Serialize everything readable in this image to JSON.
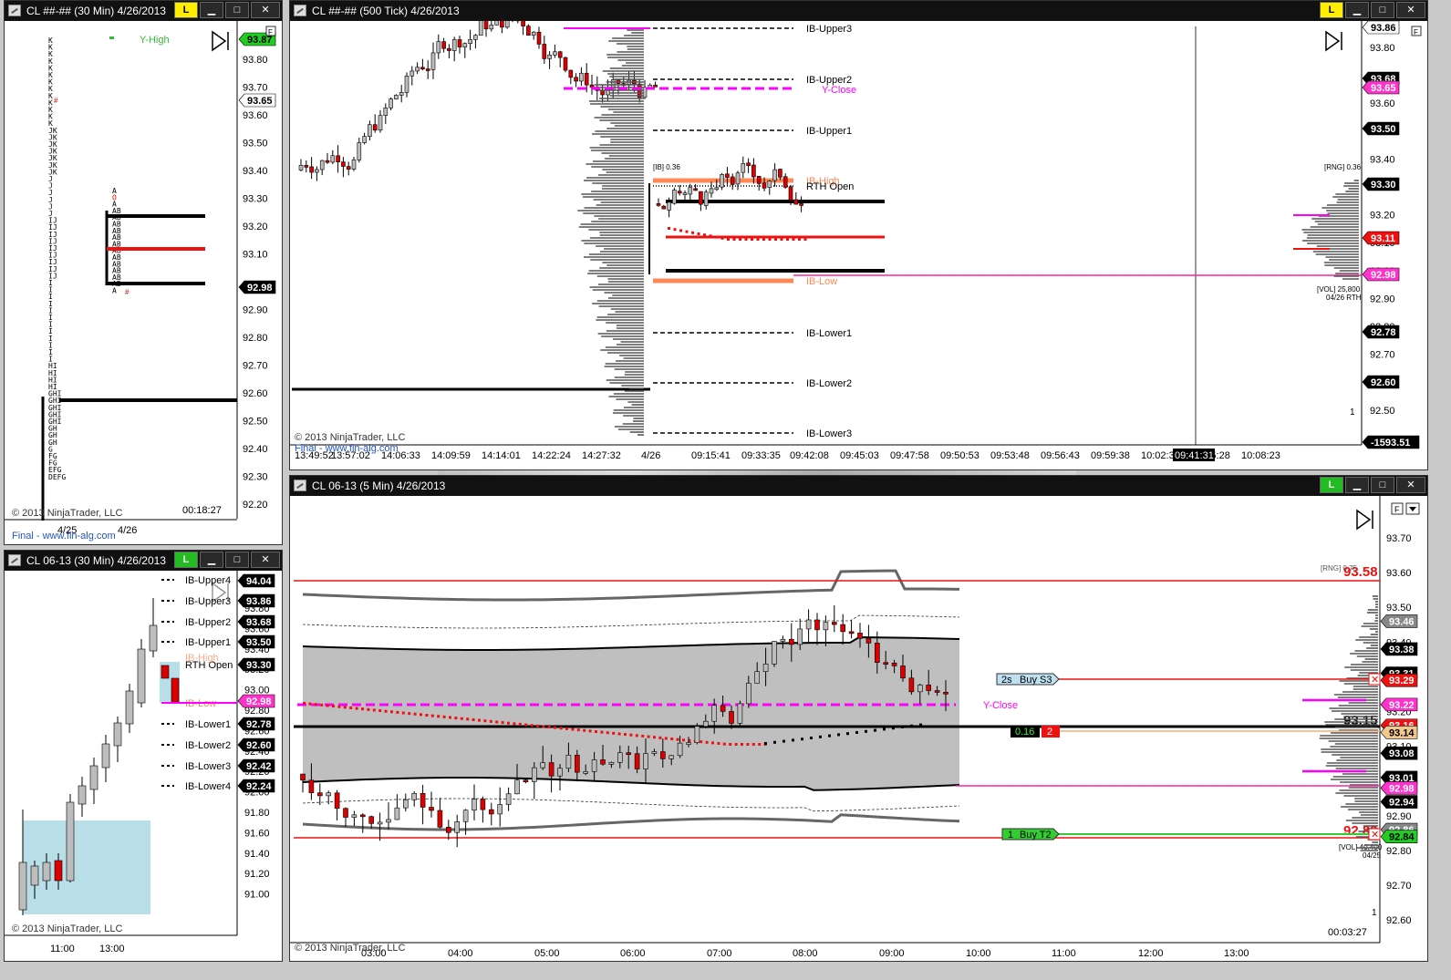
{
  "windows": {
    "tpo30": {
      "title": "CL ##-## (30 Min)  4/26/2013",
      "link_badge": "L",
      "prices": [
        "93.80",
        "93.70",
        "93.60",
        "93.50",
        "93.40",
        "93.30",
        "93.20",
        "93.10",
        "92.90",
        "92.80",
        "92.70",
        "92.60",
        "92.50",
        "92.40",
        "92.30",
        "92.20"
      ],
      "price_tags": [
        {
          "label": "93.87",
          "style": "green"
        },
        {
          "label": "93.65",
          "style": "white"
        },
        {
          "label": "92.98",
          "style": "black"
        }
      ],
      "y_high_label": "Y-High",
      "dates": [
        "4/25",
        "4/26"
      ],
      "timer": "00:18:27",
      "copyright": "© 2013 NinjaTrader, LLC",
      "final_link": "Final - www.fin-alg.com",
      "tpo_col1": [
        "K",
        "K",
        "K",
        "K",
        "K",
        "K",
        "K",
        "K",
        "K",
        "K",
        "K",
        "K",
        "K",
        "JK",
        "JK",
        "JK",
        "JK",
        "JK",
        "JK",
        "JK",
        "J",
        "J",
        "J",
        "J",
        "J",
        "J",
        "IJ",
        "IJ",
        "IJ",
        "IJ",
        "IJ",
        "IJ",
        "IJ",
        "IJ",
        "IJ",
        "I",
        "I",
        "I",
        "I",
        "I",
        "I",
        "I",
        "I",
        "I",
        "I",
        "I",
        "I",
        "HI",
        "HI",
        "HI",
        "HI",
        "GHI",
        "GHI",
        "GHI",
        "GHI",
        "GHI",
        "GH",
        "GH",
        "GH",
        "G",
        "FG",
        "FG",
        "EFG",
        "DEFG"
      ],
      "tpo_col2": [
        "A",
        "O",
        "A",
        "AB",
        "AB",
        "AB",
        "AB",
        "AB",
        "AB",
        "AB",
        "AB",
        "AB",
        "AB",
        "AB",
        "AB",
        "A"
      ]
    },
    "tick500": {
      "title": "CL ##-## (500 Tick)  4/26/2013",
      "link_badge": "L",
      "prices": [
        "93.80",
        "93.70",
        "93.60",
        "93.50",
        "93.40",
        "93.30",
        "93.20",
        "93.10",
        "93.00",
        "92.90",
        "92.80",
        "92.70",
        "92.60",
        "92.50"
      ],
      "price_tags": [
        {
          "label": "93.86",
          "style": "white"
        },
        {
          "label": "93.68",
          "style": "black"
        },
        {
          "label": "93.65",
          "style": "magenta"
        },
        {
          "label": "93.50",
          "style": "black"
        },
        {
          "label": "93.30",
          "style": "black"
        },
        {
          "label": "93.11",
          "style": "red"
        },
        {
          "label": "92.98",
          "style": "magenta"
        },
        {
          "label": "92.78",
          "style": "black"
        },
        {
          "label": "92.60",
          "style": "black"
        },
        {
          "label": "-1593.51",
          "style": "black"
        }
      ],
      "levels": [
        "IB-Upper3",
        "IB-Upper2",
        "Y-Close",
        "IB-Upper1",
        "IB-High",
        "RTH Open",
        "IB-Low",
        "IB-Lower1",
        "IB-Lower2",
        "IB-Lower3"
      ],
      "ib_tag": "[IB] 0.36",
      "rng_tag": "[RNG] 0.36",
      "vol_tag": "[VOL] 25,800",
      "vol_sub": "04/26 RTH",
      "count_label": "1",
      "times": [
        "13:49:52",
        "13:57:02",
        "14:06:33",
        "14:09:59",
        "14:14:01",
        "14:22:24",
        "14:27:32",
        "4/26",
        "09:15:41",
        "09:33:35",
        "09:42:08",
        "09:45:03",
        "09:47:58",
        "09:50:53",
        "09:53:48",
        "09:56:43",
        "09:59:38",
        "10:02:33",
        "10:05:28",
        "10:08:23"
      ],
      "cursor_time": "09:41:31",
      "copyright": "© 2013 NinjaTrader, LLC",
      "final_link": "Final - www.fin-alg.com"
    },
    "min30": {
      "title": "CL 06-13 (30 Min)  4/26/2013",
      "link_badge": "L",
      "prices": [
        "93.80",
        "93.60",
        "93.40",
        "93.20",
        "93.00",
        "92.80",
        "92.60",
        "92.40",
        "92.20",
        "92.00",
        "91.80",
        "91.60",
        "91.40",
        "91.20",
        "91.00"
      ],
      "price_tags": [
        {
          "label": "94.04",
          "style": "black"
        },
        {
          "label": "93.86",
          "style": "black"
        },
        {
          "label": "93.68",
          "style": "black"
        },
        {
          "label": "93.50",
          "style": "black"
        },
        {
          "label": "93.30",
          "style": "black"
        },
        {
          "label": "92.98",
          "style": "magenta"
        },
        {
          "label": "92.78",
          "style": "black"
        },
        {
          "label": "92.60",
          "style": "black"
        },
        {
          "label": "92.42",
          "style": "black"
        },
        {
          "label": "92.24",
          "style": "black"
        }
      ],
      "levels": [
        "IB-Upper4",
        "IB-Upper3",
        "IB-Upper2",
        "IB-Upper1",
        "RTH Open",
        "IB-High",
        "IB-Low",
        "IB-Lower1",
        "IB-Lower2",
        "IB-Lower3",
        "IB-Lower4"
      ],
      "times": [
        "11:00",
        "13:00"
      ],
      "copyright": "© 2013 NinjaTrader, LLC"
    },
    "min5": {
      "title": "CL 06-13 (5 Min)  4/26/2013",
      "link_badge": "L",
      "prices": [
        "93.70",
        "93.60",
        "93.50",
        "93.40",
        "93.30",
        "93.20",
        "93.10",
        "93.00",
        "92.90",
        "92.80",
        "92.70",
        "92.60"
      ],
      "price_tags": [
        {
          "label": "93.46",
          "style": "gray"
        },
        {
          "label": "93.38",
          "style": "black"
        },
        {
          "label": "93.31",
          "style": "black"
        },
        {
          "label": "93.29",
          "style": "red"
        },
        {
          "label": "93.22",
          "style": "magenta"
        },
        {
          "label": "93.16",
          "style": "red"
        },
        {
          "label": "93.14",
          "style": "tan"
        },
        {
          "label": "93.08",
          "style": "black"
        },
        {
          "label": "93.01",
          "style": "black"
        },
        {
          "label": "92.98",
          "style": "magenta"
        },
        {
          "label": "92.94",
          "style": "black"
        },
        {
          "label": "92.86",
          "style": "gray"
        },
        {
          "label": "92.84",
          "style": "green"
        }
      ],
      "high_label": "93.58",
      "low_label": "92.83",
      "last_label": "93.15",
      "rng_tag": "[RNG] 0.75",
      "vol_tag": "[VOL] 40,400",
      "vol_sub": "04/25",
      "count_label": "1",
      "timer": "00:03:27",
      "y_close": "Y-Close",
      "order_stop": {
        "qty": "2s",
        "label": "Buy S3"
      },
      "order_target": {
        "qty": "1",
        "label": "Buy T2"
      },
      "position": {
        "pnl": "0.16",
        "qty": "2"
      },
      "times": [
        "03:00",
        "04:00",
        "05:00",
        "06:00",
        "07:00",
        "08:00",
        "09:00",
        "10:00",
        "11:00",
        "12:00",
        "13:00"
      ],
      "copyright": "© 2013 NinjaTrader, LLC"
    }
  },
  "colors": {
    "bull": "#ffffff",
    "bear": "#dd0000",
    "magenta": "#ff00ff",
    "ib": "#ff8855",
    "band": "#bfbfbf"
  }
}
